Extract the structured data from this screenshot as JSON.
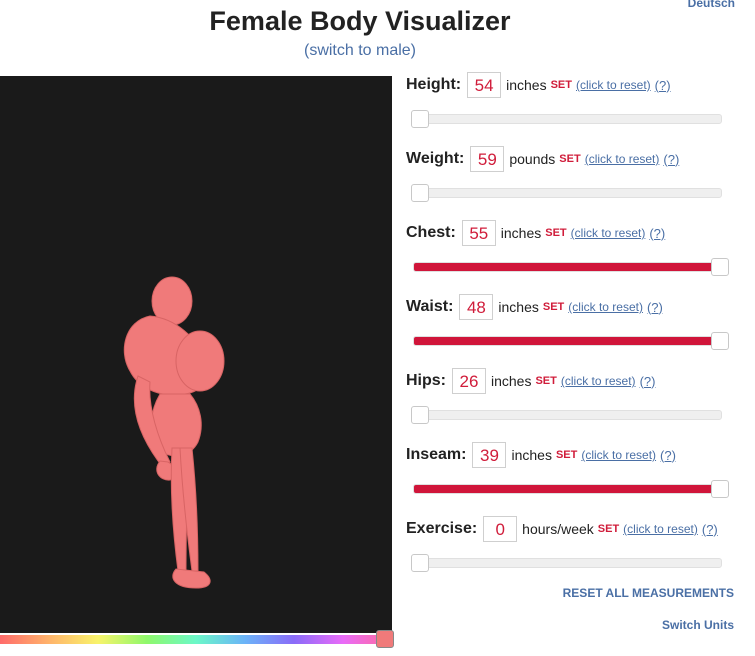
{
  "language_link": "Deutsch",
  "title": "Female Body Visualizer",
  "switch_sex": "(switch to male)",
  "viewer": {
    "skin_color": "#f07a7a",
    "background": "#1a1a1a",
    "hue_position": 0.97
  },
  "measurements": [
    {
      "label": "Height:",
      "value": "54",
      "unit": "inches",
      "set": "SET",
      "reset": "(click to reset)",
      "help": "(?)",
      "fraction": 0.0
    },
    {
      "label": "Weight:",
      "value": "59",
      "unit": "pounds",
      "set": "SET",
      "reset": "(click to reset)",
      "help": "(?)",
      "fraction": 0.0
    },
    {
      "label": "Chest:",
      "value": "55",
      "unit": "inches",
      "set": "SET",
      "reset": "(click to reset)",
      "help": "(?)",
      "fraction": 1.0
    },
    {
      "label": "Waist:",
      "value": "48",
      "unit": "inches",
      "set": "SET",
      "reset": "(click to reset)",
      "help": "(?)",
      "fraction": 1.0
    },
    {
      "label": "Hips:",
      "value": "26",
      "unit": "inches",
      "set": "SET",
      "reset": "(click to reset)",
      "help": "(?)",
      "fraction": 0.0
    },
    {
      "label": "Inseam:",
      "value": "39",
      "unit": "inches",
      "set": "SET",
      "reset": "(click to reset)",
      "help": "(?)",
      "fraction": 1.0
    },
    {
      "label": "Exercise:",
      "value": "0",
      "unit": "hours/week",
      "set": "SET",
      "reset": "(click to reset)",
      "help": "(?)",
      "fraction": 0.0
    }
  ],
  "reset_all": "RESET ALL MEASUREMENTS",
  "switch_units": "Switch Units"
}
